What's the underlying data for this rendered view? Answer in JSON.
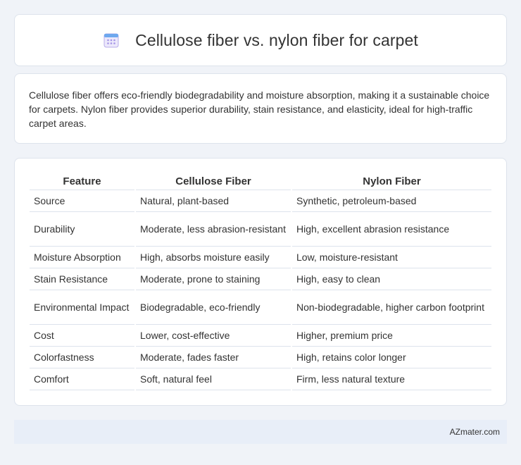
{
  "header": {
    "title": "Cellulose fiber vs. nylon fiber for carpet",
    "icon": "calendar-icon"
  },
  "summary": {
    "text": "Cellulose fiber offers eco-friendly biodegradability and moisture absorption, making it a sustainable choice for carpets. Nylon fiber provides superior durability, stain resistance, and elasticity, ideal for high-traffic carpet areas."
  },
  "table": {
    "headers": [
      "Feature",
      "Cellulose Fiber",
      "Nylon Fiber"
    ],
    "rows": [
      [
        "Source",
        "Natural, plant-based",
        "Synthetic, petroleum-based"
      ],
      [
        "Durability",
        "Moderate, less abrasion-resistant",
        "High, excellent abrasion resistance"
      ],
      [
        "Moisture Absorption",
        "High, absorbs moisture easily",
        "Low, moisture-resistant"
      ],
      [
        "Stain Resistance",
        "Moderate, prone to staining",
        "High, easy to clean"
      ],
      [
        "Environmental Impact",
        "Biodegradable, eco-friendly",
        "Non-biodegradable, higher carbon footprint"
      ],
      [
        "Cost",
        "Lower, cost-effective",
        "Higher, premium price"
      ],
      [
        "Colorfastness",
        "Moderate, fades faster",
        "High, retains color longer"
      ],
      [
        "Comfort",
        "Soft, natural feel",
        "Firm, less natural texture"
      ]
    ]
  },
  "footer": {
    "brand": "AZmater.com"
  },
  "colors": {
    "background": "#f0f3f8",
    "card": "#ffffff",
    "border": "#dde3ec",
    "footer_bg": "#e8eef8",
    "icon_accent": "#9b8ce0"
  }
}
